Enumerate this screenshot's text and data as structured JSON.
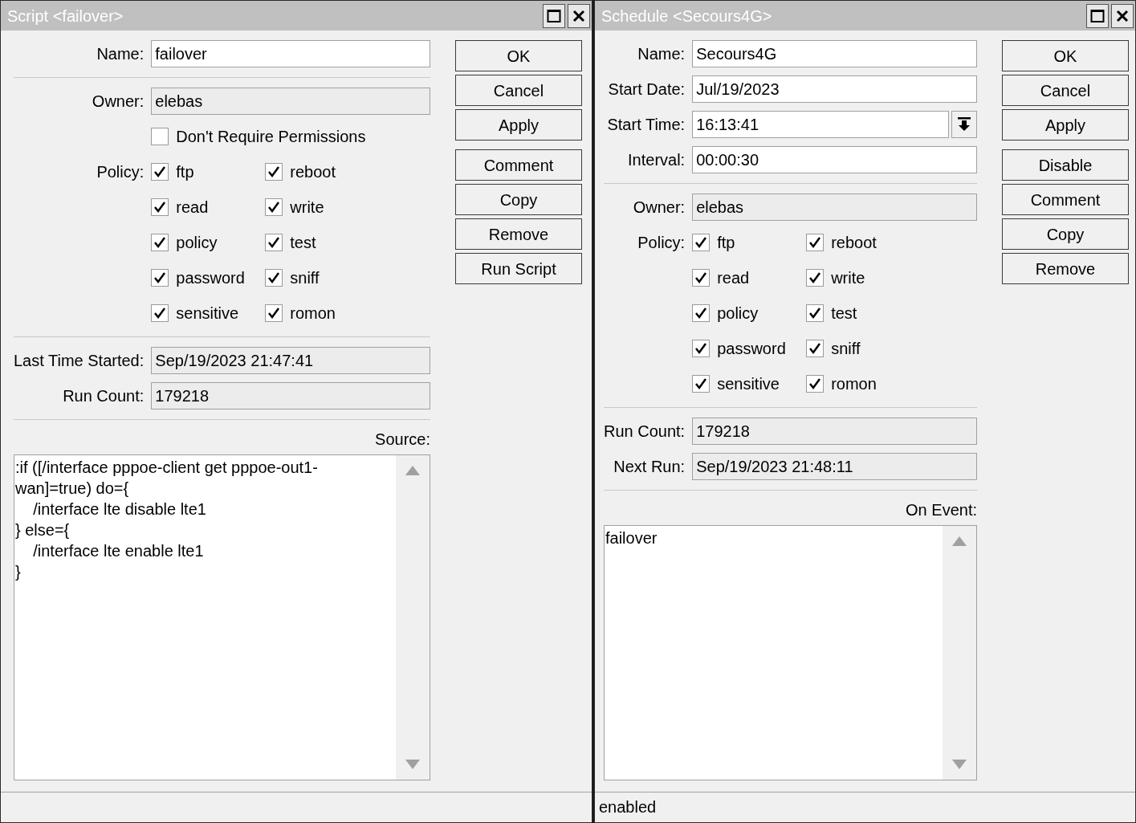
{
  "windows": [
    {
      "title": "Script <failover>",
      "sections": [
        [
          {
            "kind": "field",
            "label": "Name:",
            "value": "failover",
            "read_only": false
          }
        ],
        [
          {
            "kind": "field",
            "label": "Owner:",
            "value": "elebas",
            "read_only": true
          },
          {
            "kind": "checkbox",
            "label": "Don't Require Permissions",
            "checked": false
          },
          {
            "kind": "policy",
            "label": "Policy:",
            "options": [
              {
                "label": "ftp",
                "checked": true
              },
              {
                "label": "reboot",
                "checked": true
              },
              {
                "label": "read",
                "checked": true
              },
              {
                "label": "write",
                "checked": true
              },
              {
                "label": "policy",
                "checked": true
              },
              {
                "label": "test",
                "checked": true
              },
              {
                "label": "password",
                "checked": true
              },
              {
                "label": "sniff",
                "checked": true
              },
              {
                "label": "sensitive",
                "checked": true
              },
              {
                "label": "romon",
                "checked": true
              }
            ]
          }
        ],
        [
          {
            "kind": "field",
            "label": "Last Time Started:",
            "value": "Sep/19/2023 21:47:41",
            "read_only": true
          },
          {
            "kind": "field",
            "label": "Run Count:",
            "value": "179218",
            "read_only": true
          }
        ]
      ],
      "editor": {
        "label": "Source:",
        "lines": [
          ":if ([/interface pppoe-client get pppoe-out1-",
          "wan]=true) do={",
          "    /interface lte disable lte1",
          "} else={",
          "    /interface lte enable lte1",
          "}"
        ]
      },
      "buttons": [
        [
          "OK",
          "Cancel",
          "Apply"
        ],
        [
          "Comment",
          "Copy",
          "Remove",
          "Run Script"
        ]
      ]
    },
    {
      "title": "Schedule <Secours4G>",
      "sections": [
        [
          {
            "kind": "field",
            "label": "Name:",
            "value": "Secours4G",
            "read_only": false
          },
          {
            "kind": "field",
            "label": "Start Date:",
            "value": "Jul/19/2023",
            "read_only": false
          },
          {
            "kind": "dropdown",
            "label": "Start Time:",
            "value": "16:13:41",
            "read_only": false
          },
          {
            "kind": "field",
            "label": "Interval:",
            "value": "00:00:30",
            "read_only": false
          }
        ],
        [
          {
            "kind": "field",
            "label": "Owner:",
            "value": "elebas",
            "read_only": true
          },
          {
            "kind": "policy",
            "label": "Policy:",
            "options": [
              {
                "label": "ftp",
                "checked": true
              },
              {
                "label": "reboot",
                "checked": true
              },
              {
                "label": "read",
                "checked": true
              },
              {
                "label": "write",
                "checked": true
              },
              {
                "label": "policy",
                "checked": true
              },
              {
                "label": "test",
                "checked": true
              },
              {
                "label": "password",
                "checked": true
              },
              {
                "label": "sniff",
                "checked": true
              },
              {
                "label": "sensitive",
                "checked": true
              },
              {
                "label": "romon",
                "checked": true
              }
            ]
          }
        ],
        [
          {
            "kind": "field",
            "label": "Run Count:",
            "value": "179218",
            "read_only": true
          },
          {
            "kind": "field",
            "label": "Next Run:",
            "value": "Sep/19/2023 21:48:11",
            "read_only": true
          }
        ]
      ],
      "editor": {
        "label": "On Event:",
        "lines": [
          "failover"
        ]
      },
      "buttons": [
        [
          "OK",
          "Cancel",
          "Apply"
        ],
        [
          "Disable",
          "Comment",
          "Copy",
          "Remove"
        ]
      ],
      "status": "enabled"
    }
  ]
}
